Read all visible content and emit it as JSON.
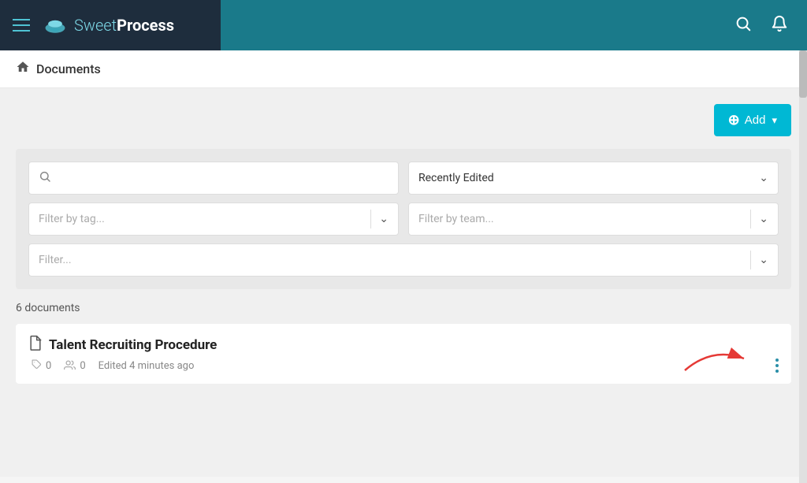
{
  "navbar": {
    "hamburger_label": "menu",
    "logo_sweet": "Sweet",
    "logo_process": "Process",
    "search_label": "search",
    "bell_label": "notifications"
  },
  "breadcrumb": {
    "home_label": "home",
    "page_title": "Documents"
  },
  "toolbar": {
    "add_button_label": "Add"
  },
  "filters": {
    "search_placeholder": "",
    "sort_label": "Recently Edited",
    "filter_tag_placeholder": "Filter by tag...",
    "filter_team_placeholder": "Filter by team...",
    "filter_placeholder": "Filter..."
  },
  "documents": {
    "count_label": "6 documents",
    "items": [
      {
        "title": "Talent Recruiting Procedure",
        "icon": "📄",
        "tags_count": "0",
        "members_count": "0",
        "edited": "Edited 4 minutes ago"
      }
    ]
  }
}
